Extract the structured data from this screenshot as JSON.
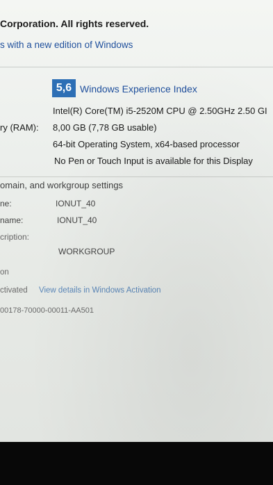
{
  "copyright": "Corporation. All rights reserved.",
  "edition_link": "s with a new edition of Windows",
  "system": {
    "rating": "5,6",
    "rating_link": "Windows Experience Index",
    "processor": "Intel(R) Core(TM) i5-2520M CPU @ 2.50GHz   2.50 GI",
    "ram_label": "ry (RAM):",
    "ram": "8,00 GB (7,78 GB usable)",
    "system_type": "64-bit Operating System, x64-based processor",
    "pen_touch": "No Pen or Touch Input is available for this Display"
  },
  "domain": {
    "section_title": "omain, and workgroup settings",
    "name_label": "ne:",
    "name_value": "IONUT_40",
    "full_name_label": "name:",
    "full_name_value": "IONUT_40",
    "description_label": "cription:",
    "workgroup_value": "WORKGROUP"
  },
  "activation": {
    "section_title": "on",
    "status": "ctivated",
    "details_link": "View details in Windows Activation",
    "product_id": "00178-70000-00011-AA501"
  }
}
